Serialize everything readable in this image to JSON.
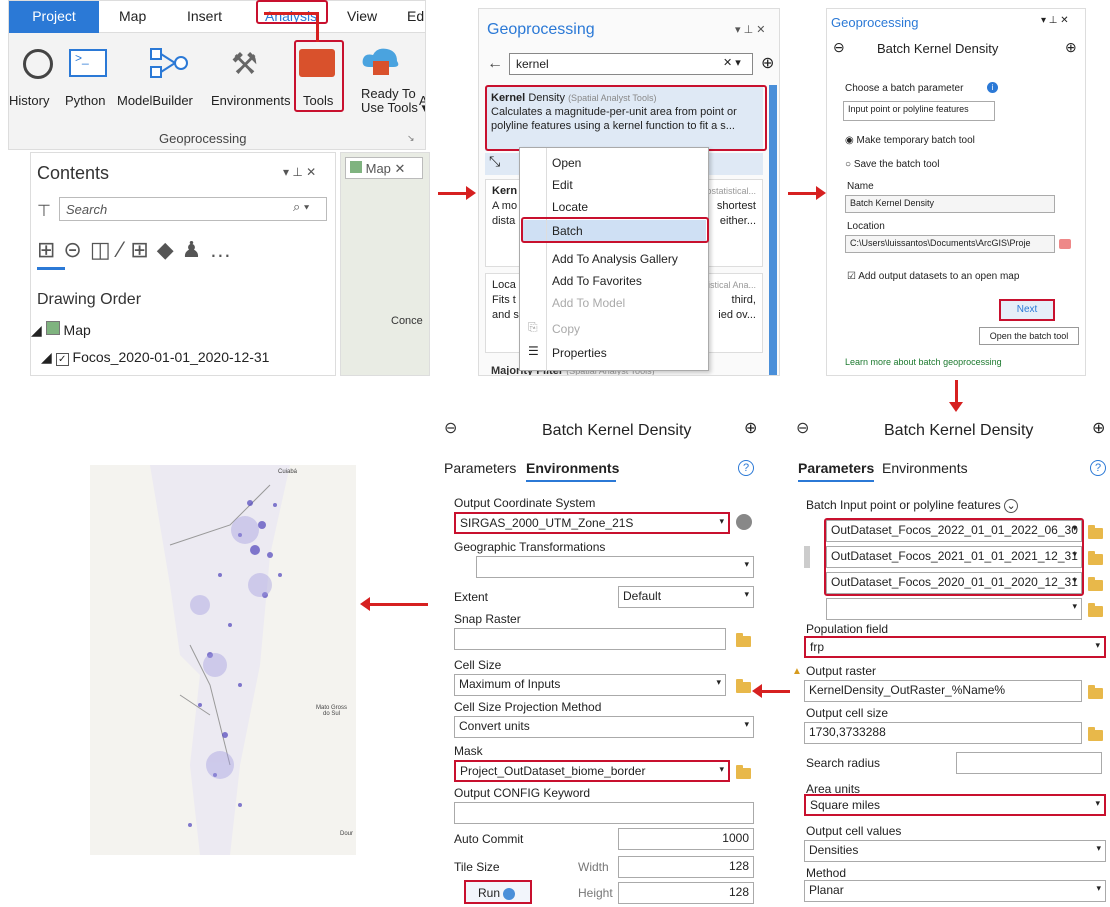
{
  "ribbon": {
    "tabs": [
      "Project",
      "Map",
      "Insert",
      "Analysis",
      "View",
      "Edi"
    ],
    "buttons": [
      "History",
      "Python",
      "ModelBuilder",
      "Environments",
      "Tools",
      "Ready To",
      "Use Tools ▾",
      "A"
    ],
    "group": "Geoprocessing"
  },
  "contents": {
    "title": "Contents",
    "search_placeholder": "Search",
    "drawing_order": "Drawing Order",
    "map_item": "Map",
    "layer": "Focos_2020-01-01_2020-12-31",
    "map_tab": "Map",
    "map_label": "Conce"
  },
  "geo": {
    "title": "Geoprocessing",
    "search": "kernel",
    "tool1_name": "Kernel",
    "tool1_name2": "Density",
    "tool1_sub": "(Spatial Analyst Tools)",
    "tool1_desc": "Calculates a magnitude-per-unit area from point or polyline features using a kernel function to fit a s...",
    "tool2_name": "Kern",
    "tool2_sub": "eostatistical...",
    "tool2_desc1": "A mo",
    "tool2_desc1b": "shortest",
    "tool2_desc2": "dista",
    "tool2_desc2b": "either...",
    "tool3_name": "Loca",
    "tool3_sub": "tistical Ana...",
    "tool3_desc1": "Fits t",
    "tool3_desc1b": "third,",
    "tool3_desc2": "and s",
    "tool3_desc2b": "ied ov...",
    "tool4": "Majority Filter",
    "tool4_sub": "(Spatial Analyst Tools)",
    "menu": [
      "Open",
      "Edit",
      "Locate",
      "Batch",
      "Add To Analysis Gallery",
      "Add To Favorites",
      "Add To Model",
      "Copy",
      "Properties"
    ]
  },
  "batch1": {
    "title": "Geoprocessing",
    "header": "Batch Kernel Density",
    "choose": "Choose a batch parameter",
    "param": "Input point or polyline features",
    "opt1": "Make temporary batch tool",
    "opt2": "Save the batch tool",
    "name_lbl": "Name",
    "name_val": "Batch Kernel Density",
    "loc_lbl": "Location",
    "loc_val": "C:\\Users\\luissantos\\Documents\\ArcGIS\\Proje",
    "add_out": "Add output datasets to an open map",
    "next": "Next",
    "tooltip": "Open the batch tool",
    "learn": "Learn more about batch geoprocessing"
  },
  "env": {
    "header": "Batch Kernel Density",
    "tab_params": "Parameters",
    "tab_env": "Environments",
    "ocs_lbl": "Output Coordinate System",
    "ocs": "SIRGAS_2000_UTM_Zone_21S",
    "gt_lbl": "Geographic Transformations",
    "extent_lbl": "Extent",
    "extent": "Default",
    "snap_lbl": "Snap Raster",
    "cell_lbl": "Cell Size",
    "cell": "Maximum of Inputs",
    "cspm_lbl": "Cell Size Projection Method",
    "cspm": "Convert units",
    "mask_lbl": "Mask",
    "mask": "Project_OutDataset_biome_border",
    "config_lbl": "Output CONFIG Keyword",
    "auto_lbl": "Auto Commit",
    "auto": "1000",
    "tile_lbl": "Tile Size",
    "width_lbl": "Width",
    "width": "128",
    "height_lbl": "Height",
    "height": "128",
    "run": "Run"
  },
  "params": {
    "header": "Batch Kernel Density",
    "tab_params": "Parameters",
    "tab_env": "Environments",
    "batch_lbl": "Batch Input point or polyline features",
    "inputs": [
      "OutDataset_Focos_2022_01_01_2022_06_30",
      "OutDataset_Focos_2021_01_01_2021_12_31",
      "OutDataset_Focos_2020_01_01_2020_12_31"
    ],
    "pop_lbl": "Population field",
    "pop": "frp",
    "out_lbl": "Output raster",
    "out": "KernelDensity_OutRaster_%Name%",
    "cellsize_lbl": "Output cell size",
    "cellsize": "1730,3733288",
    "radius_lbl": "Search radius",
    "area_lbl": "Area units",
    "area": "Square miles",
    "vals_lbl": "Output cell values",
    "vals": "Densities",
    "method_lbl": "Method",
    "method": "Planar"
  },
  "map2": {
    "label1": "Cuiabá",
    "label2": "Mato Gross\ndo Sul",
    "label3": "Dour"
  }
}
